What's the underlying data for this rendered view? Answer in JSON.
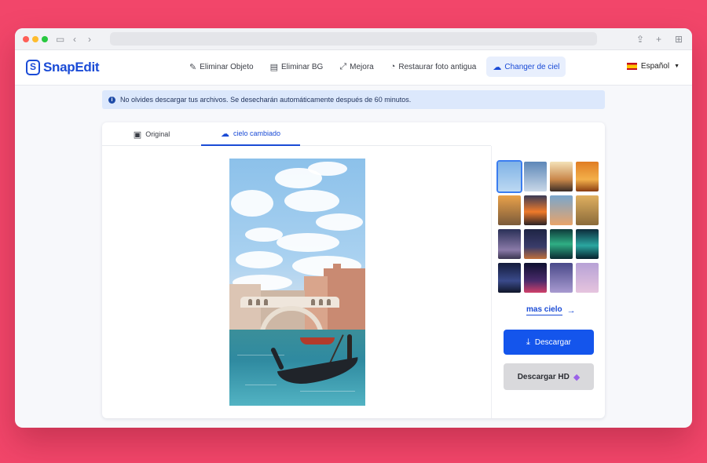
{
  "header": {
    "logo_mark": "S",
    "logo_text": "SnapEdit",
    "nav": [
      {
        "label": "Eliminar Objeto",
        "icon": "eraser-icon",
        "glyph": "✎"
      },
      {
        "label": "Eliminar BG",
        "icon": "remove-bg-icon",
        "glyph": "▤"
      },
      {
        "label": "Mejora",
        "icon": "enhance-icon",
        "glyph": "⤢"
      },
      {
        "label": "Restaurar foto antigua",
        "icon": "restore-photo-icon",
        "glyph": "◔"
      },
      {
        "label": "Changer de ciel",
        "icon": "sky-icon",
        "glyph": "☁",
        "active": true
      }
    ],
    "language": "Español"
  },
  "notice": {
    "text": "No olvides descargar tus archivos. Se desecharán automáticamente después de 60 minutos."
  },
  "tabs": {
    "original": "Original",
    "changed": "cielo cambiado"
  },
  "sidebar": {
    "more_sky": "mas cielo",
    "download": "Descargar",
    "download_hd": "Descargar HD"
  },
  "colors": {
    "accent": "#1a4bd6",
    "primary_button": "#1455ec",
    "background": "#f2466a"
  }
}
